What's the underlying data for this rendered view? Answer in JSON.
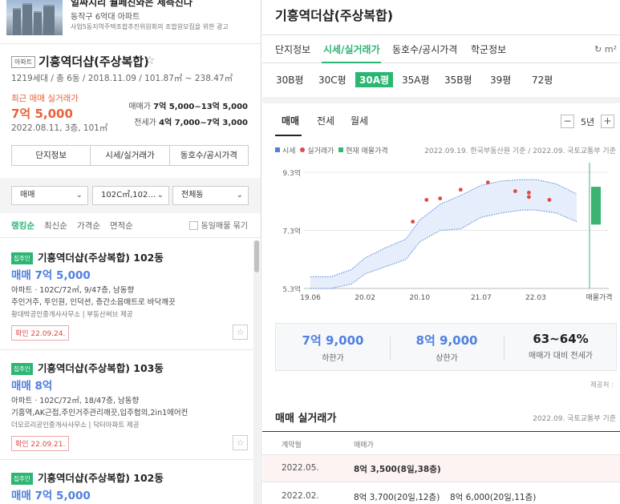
{
  "news": {
    "headline": "일싸지리 월페진와은 세측진다",
    "subline": "동작구 6억대 아파트",
    "caption": "사업5동지역주택조합추진위원회의 조합원모집을 위한 광고"
  },
  "apartment": {
    "type_badge": "아파트",
    "title": "기흥역더샵(주상복합)",
    "star": "☆",
    "info": "1219세대 / 총 6동 / 2018.11.09 / 101.87㎡ ~ 238.47㎡",
    "recent_label": "최근 매매 실거래가",
    "recent_price": "7억 5,000",
    "recent_date": "2022.08.11, 3층, 101㎡",
    "trade_key": "매매가",
    "trade_range": "7억 5,000~13억 5,000",
    "rent_key": "전세가",
    "rent_range": "4억 7,000~7억 3,000"
  },
  "left_tabs": [
    "단지정보",
    "시세/실거래가",
    "동호수/공시가격"
  ],
  "filters": {
    "deal": "매매",
    "area": "102C㎡,102…",
    "dong": "전체동",
    "chevron": "⌄"
  },
  "sort": {
    "options": [
      "랭킹순",
      "최신순",
      "가격순",
      "면적순"
    ],
    "same_listing": "동일매물 묶기"
  },
  "listings": [
    {
      "badge": "집주인",
      "name": "기흥역더샵(주상복합) 102동",
      "price": "매매 7억 5,000",
      "spec": "아파트 · 102C/72㎡, 9/47층, 남동향",
      "features": "주인거주, 투인원, 인덕션, 층간소음매트로 바닥깨끗",
      "agent": "황대박공인중개사사무소 | 부동산써브 제공",
      "confirm": "확인 22.09.24.",
      "fav": "☆"
    },
    {
      "badge": "집주인",
      "name": "기흥역더샵(주상복합) 103동",
      "price": "매매 8억",
      "spec": "아파트 · 102C/72㎡, 18/47층, 남동향",
      "features": "기흥역,AK근접,주인거주관리깨끗,입주협의,2in1에어컨",
      "agent": "더모르리공인중개사사무소 | 닥터아파트 제공",
      "confirm": "확인 22.09.21.",
      "fav": "☆"
    },
    {
      "badge": "집주인",
      "name": "기흥역더샵(주상복합) 102동",
      "price": "매매 7억 5,000"
    }
  ],
  "right": {
    "title": "기흥역더샵(주상복합)",
    "tabs": [
      "단지정보",
      "시세/실거래가",
      "동호수/공시가격",
      "학군정보"
    ],
    "refresh": "↻ m²",
    "areas": [
      "30B평",
      "30C평",
      "30A평",
      "35A평",
      "35B평",
      "39평",
      "72평"
    ],
    "chart_tabs": [
      "매매",
      "전세",
      "월세"
    ],
    "minus": "−",
    "plus": "+",
    "period": "5년",
    "legend": [
      "시세",
      "실거래가",
      "현재 매물가격"
    ],
    "source": "2022.09.19. 한국부동산원 기준 / 2022.09. 국토교통부 기준",
    "summary": [
      {
        "value": "7억 9,000",
        "label": "하한가"
      },
      {
        "value": "8억 9,000",
        "label": "상한가"
      },
      {
        "value": "63~64%",
        "label": "매매가 대비 전세가"
      }
    ],
    "provider": "제공처 :",
    "trades_title": "매매 실거래가",
    "trades_source": "2022.09. 국토교통부 기준",
    "trades_headers": [
      "계약월",
      "매매가"
    ],
    "trades": [
      {
        "month": "2022.05.",
        "items": [
          "8억 3,500(8일,38층)"
        ]
      },
      {
        "month": "2022.02.",
        "items": [
          "8억 3,700(20일,12층)",
          "8억 6,000(20일,11층)"
        ]
      }
    ]
  },
  "chart_data": {
    "type": "area",
    "x_ticks": [
      "19.06",
      "20.02",
      "20.10",
      "21.07",
      "22.03",
      "매물가격"
    ],
    "y_ticks": [
      "9.3억",
      "7.3억",
      "5.3억"
    ],
    "ylim": [
      5.3,
      9.3
    ],
    "series": [
      {
        "name": "시세",
        "x": [
          "19.06",
          "19.09",
          "19.12",
          "20.02",
          "20.05",
          "20.08",
          "20.10",
          "21.01",
          "21.04",
          "21.07",
          "21.10",
          "22.01",
          "22.03",
          "22.06",
          "22.09"
        ],
        "lower": [
          5.3,
          5.3,
          5.45,
          5.8,
          6.05,
          6.3,
          6.9,
          7.3,
          7.35,
          7.75,
          7.9,
          8.0,
          8.0,
          7.9,
          7.6
        ],
        "upper": [
          5.7,
          5.7,
          5.95,
          6.35,
          6.7,
          7.0,
          7.65,
          8.2,
          8.5,
          8.85,
          9.0,
          9.05,
          9.05,
          8.9,
          8.55
        ]
      },
      {
        "name": "실거래가",
        "points": [
          {
            "x": "20.09",
            "y": 7.6
          },
          {
            "x": "20.11",
            "y": 8.35
          },
          {
            "x": "21.01",
            "y": 8.4
          },
          {
            "x": "21.04",
            "y": 8.7
          },
          {
            "x": "21.08",
            "y": 8.95
          },
          {
            "x": "21.12",
            "y": 8.65
          },
          {
            "x": "22.02",
            "y": 8.6
          },
          {
            "x": "22.02",
            "y": 8.45
          },
          {
            "x": "22.05",
            "y": 8.35
          }
        ]
      },
      {
        "name": "현재 매물가격",
        "range": [
          7.5,
          8.8
        ]
      }
    ],
    "colors": {
      "market": "#4f7fe0",
      "trade": "#e24848",
      "listing": "#3cb371"
    }
  }
}
